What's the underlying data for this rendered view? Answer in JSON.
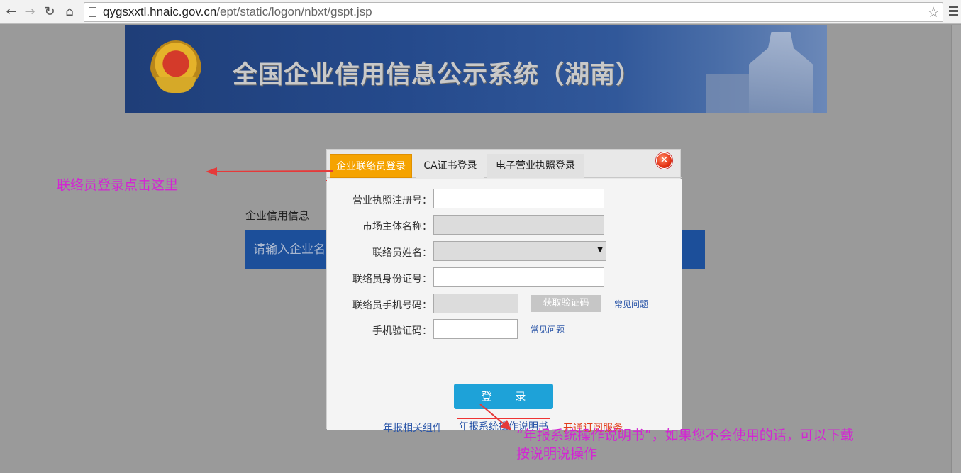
{
  "browser": {
    "url_host": "qygsxxtl.hnaic.gov.cn",
    "url_path": "/ept/static/logon/nbxt/gspt.jsp"
  },
  "banner": {
    "title": "全国企业信用信息公示系统（湖南）"
  },
  "search": {
    "label": "企业信用信息",
    "placeholder": "请输入企业名称"
  },
  "dialog": {
    "tabs": [
      {
        "label": "企业联络员登录"
      },
      {
        "label": "CA证书登录"
      },
      {
        "label": "电子营业执照登录"
      }
    ],
    "fields": {
      "license_no": "营业执照注册号：",
      "entity_name": "市场主体名称：",
      "contact_name": "联络员姓名：",
      "contact_id": "联络员身份证号：",
      "contact_phone": "联络员手机号码：",
      "sms_code": "手机验证码："
    },
    "get_code_label": "获取验证码",
    "faq_label": "常见问题",
    "login_label": "登 录",
    "links": {
      "components": "年报相关组件",
      "manual": "年报系统操作说明书",
      "subscribe": "开通订阅服务"
    }
  },
  "annotations": {
    "contact_login_hint": "联络员登录点击这里",
    "manual_hint_line1": "“年报系统操作说明书”，如果您不会使用的话，可以下载",
    "manual_hint_line2": "按说明说操作"
  },
  "colors": {
    "active_tab": "#f5a300",
    "login_button": "#1ea2d8",
    "annotation": "#d326d3",
    "highlight_box": "#ee3333"
  }
}
